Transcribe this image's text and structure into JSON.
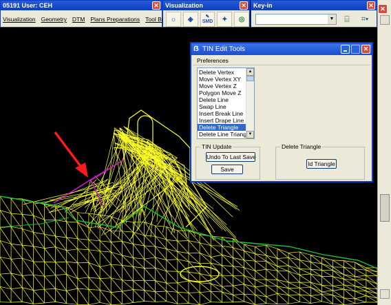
{
  "main_window": {
    "title": "05191  User: CEH",
    "menu": [
      "Visualization",
      "Geometry",
      "DTM",
      "Plans Preparations",
      "Tool Boxes"
    ]
  },
  "visualization_toolbar": {
    "title": "Visualization",
    "icons": [
      "render-icon",
      "render-settings-icon",
      "smd-icon",
      "lights-icon",
      "animation-icon",
      "view-search-icon"
    ],
    "smd_label": "SMD"
  },
  "keyin_window": {
    "title": "Key-in",
    "input_value": "",
    "icons": [
      "keyin-browse-icon",
      "keyin-options-icon"
    ]
  },
  "tin_edit_tools": {
    "title": "TIN Edit Tools",
    "preferences_label": "Preferences",
    "list_items": [
      "Delete Vertex",
      "Move Vertex XY",
      "Move Vertex Z",
      "Polygon Move Z",
      "Delete Line",
      "Swap Line",
      "Insert Break Line",
      "Insert Drape Line",
      "Delete Triangle",
      "Delete Line Triangles"
    ],
    "selected_index": 8,
    "tin_update_label": "TIN Update",
    "undo_button": "Undo To Last Save",
    "save_button": "Save",
    "delete_triangle_label": "Delete Triangle",
    "id_triangle_button": "Id Triangle"
  },
  "colors": {
    "mesh": "#ffff2a",
    "boundary": "#18c23a",
    "break_line": "#c21ec8",
    "arrow": "#ff1a1a",
    "titlebar": "#0a3fbf"
  }
}
